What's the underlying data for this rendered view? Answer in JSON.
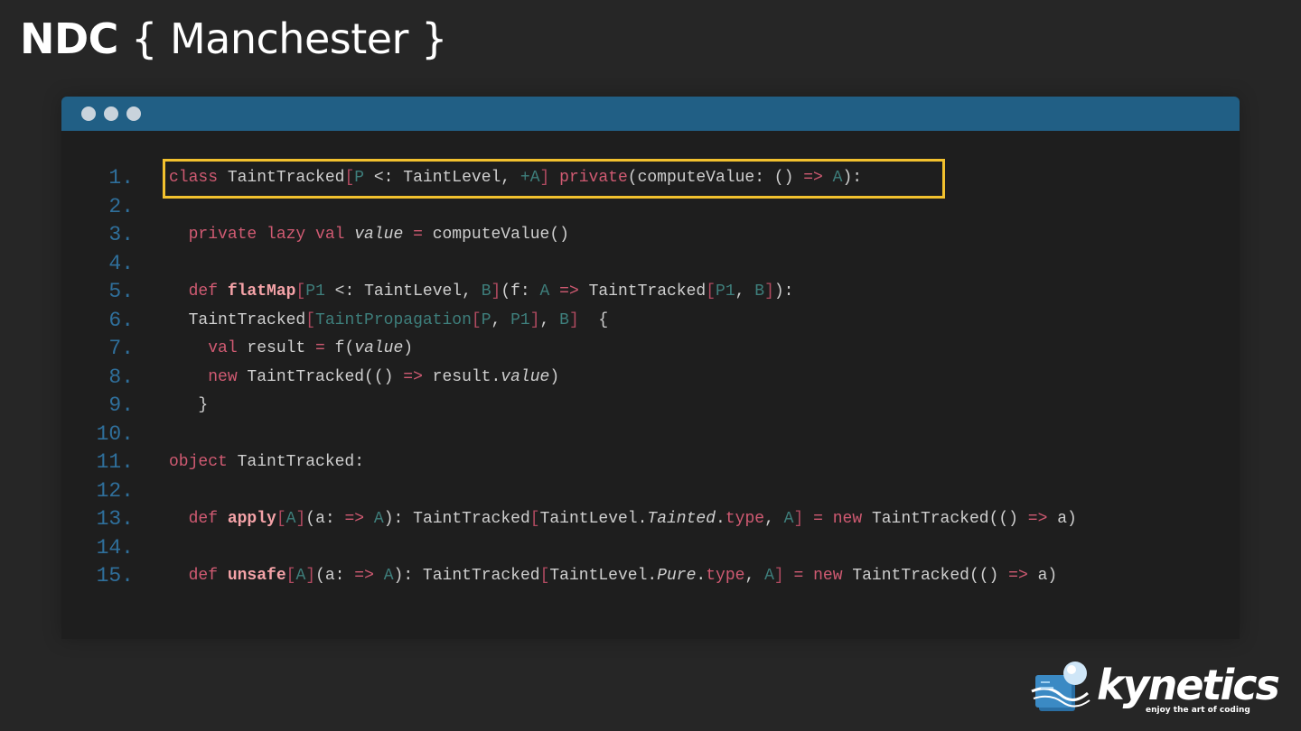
{
  "header": {
    "brand_bold": "NDC",
    "brand_light": "{ Manchester }"
  },
  "editor": {
    "lines": [
      {
        "num": "1."
      },
      {
        "num": "2."
      },
      {
        "num": "3."
      },
      {
        "num": "4."
      },
      {
        "num": "5."
      },
      {
        "num": "6."
      },
      {
        "num": "7."
      },
      {
        "num": "8."
      },
      {
        "num": "9."
      },
      {
        "num": "10."
      },
      {
        "num": "11."
      },
      {
        "num": "12."
      },
      {
        "num": "13."
      },
      {
        "num": "14."
      },
      {
        "num": "15."
      }
    ],
    "code": [
      [
        [
          "kw",
          "class"
        ],
        [
          "ty",
          " TaintTracked"
        ],
        [
          "br",
          "["
        ],
        [
          "tp",
          "P"
        ],
        [
          "ty",
          " <: TaintLevel, "
        ],
        [
          "tp",
          "+A"
        ],
        [
          "br",
          "]"
        ],
        [
          "ty",
          " "
        ],
        [
          "kw",
          "private"
        ],
        [
          "ty",
          "(computeValue: () "
        ],
        [
          "kw",
          "=>"
        ],
        [
          "ty",
          " "
        ],
        [
          "tp",
          "A"
        ],
        [
          "ty",
          "):"
        ]
      ],
      [],
      [
        [
          "ty",
          "  "
        ],
        [
          "kw",
          "private lazy val"
        ],
        [
          "ty",
          " "
        ],
        [
          "it",
          "value"
        ],
        [
          "ty",
          " "
        ],
        [
          "kw",
          "="
        ],
        [
          "ty",
          " computeValue()"
        ]
      ],
      [],
      [
        [
          "ty",
          "  "
        ],
        [
          "kw",
          "def"
        ],
        [
          "ty",
          " "
        ],
        [
          "fn",
          "flatMap"
        ],
        [
          "br",
          "["
        ],
        [
          "tp",
          "P1"
        ],
        [
          "ty",
          " <: TaintLevel, "
        ],
        [
          "tp",
          "B"
        ],
        [
          "br",
          "]"
        ],
        [
          "ty",
          "(f: "
        ],
        [
          "tp",
          "A"
        ],
        [
          "ty",
          " "
        ],
        [
          "kw",
          "=>"
        ],
        [
          "ty",
          " TaintTracked"
        ],
        [
          "br",
          "["
        ],
        [
          "tp",
          "P1"
        ],
        [
          "ty",
          ", "
        ],
        [
          "tp",
          "B"
        ],
        [
          "br",
          "]"
        ],
        [
          "ty",
          "):"
        ]
      ],
      [
        [
          "ty",
          "  TaintTracked"
        ],
        [
          "br",
          "["
        ],
        [
          "tp",
          "TaintPropagation"
        ],
        [
          "br",
          "["
        ],
        [
          "tp",
          "P"
        ],
        [
          "ty",
          ", "
        ],
        [
          "tp",
          "P1"
        ],
        [
          "br",
          "]"
        ],
        [
          "ty",
          ", "
        ],
        [
          "tp",
          "B"
        ],
        [
          "br",
          "]"
        ],
        [
          "ty",
          "  {"
        ]
      ],
      [
        [
          "ty",
          "    "
        ],
        [
          "kw",
          "val"
        ],
        [
          "ty",
          " result "
        ],
        [
          "kw",
          "="
        ],
        [
          "ty",
          " f("
        ],
        [
          "it",
          "value"
        ],
        [
          "ty",
          ")"
        ]
      ],
      [
        [
          "ty",
          "    "
        ],
        [
          "kw",
          "new"
        ],
        [
          "ty",
          " TaintTracked(() "
        ],
        [
          "kw",
          "=>"
        ],
        [
          "ty",
          " result."
        ],
        [
          "it",
          "value"
        ],
        [
          "ty",
          ")"
        ]
      ],
      [
        [
          "ty",
          "   }"
        ]
      ],
      [],
      [
        [
          "kw",
          "object"
        ],
        [
          "ty",
          " TaintTracked:"
        ]
      ],
      [],
      [
        [
          "ty",
          "  "
        ],
        [
          "kw",
          "def"
        ],
        [
          "ty",
          " "
        ],
        [
          "fn",
          "apply"
        ],
        [
          "br",
          "["
        ],
        [
          "tp",
          "A"
        ],
        [
          "br",
          "]"
        ],
        [
          "ty",
          "(a: "
        ],
        [
          "kw",
          "=>"
        ],
        [
          "ty",
          " "
        ],
        [
          "tp",
          "A"
        ],
        [
          "ty",
          "): TaintTracked"
        ],
        [
          "br",
          "["
        ],
        [
          "ty",
          "TaintLevel."
        ],
        [
          "it",
          "Tainted"
        ],
        [
          "ty",
          "."
        ],
        [
          "kw",
          "type"
        ],
        [
          "ty",
          ", "
        ],
        [
          "tp",
          "A"
        ],
        [
          "br",
          "]"
        ],
        [
          "ty",
          " "
        ],
        [
          "kw",
          "="
        ],
        [
          "ty",
          " "
        ],
        [
          "kw",
          "new"
        ],
        [
          "ty",
          " TaintTracked(() "
        ],
        [
          "kw",
          "=>"
        ],
        [
          "ty",
          " a)"
        ]
      ],
      [],
      [
        [
          "ty",
          "  "
        ],
        [
          "kw",
          "def"
        ],
        [
          "ty",
          " "
        ],
        [
          "fn",
          "unsafe"
        ],
        [
          "br",
          "["
        ],
        [
          "tp",
          "A"
        ],
        [
          "br",
          "]"
        ],
        [
          "ty",
          "(a: "
        ],
        [
          "kw",
          "=>"
        ],
        [
          "ty",
          " "
        ],
        [
          "tp",
          "A"
        ],
        [
          "ty",
          "): TaintTracked"
        ],
        [
          "br",
          "["
        ],
        [
          "ty",
          "TaintLevel."
        ],
        [
          "it",
          "Pure"
        ],
        [
          "ty",
          "."
        ],
        [
          "kw",
          "type"
        ],
        [
          "ty",
          ", "
        ],
        [
          "tp",
          "A"
        ],
        [
          "br",
          "]"
        ],
        [
          "ty",
          " "
        ],
        [
          "kw",
          "="
        ],
        [
          "ty",
          " "
        ],
        [
          "kw",
          "new"
        ],
        [
          "ty",
          " TaintTracked(() "
        ],
        [
          "kw",
          "=>"
        ],
        [
          "ty",
          " a)"
        ]
      ]
    ]
  },
  "logo": {
    "word": "kynetics",
    "tagline": "enjoy the art of coding"
  },
  "colors": {
    "background": "#262626",
    "titlebar": "#215f85",
    "highlight": "#f2c12e",
    "keyword": "#d05a72",
    "type_param": "#3e7f7c",
    "line_number": "#2f6f9b"
  }
}
